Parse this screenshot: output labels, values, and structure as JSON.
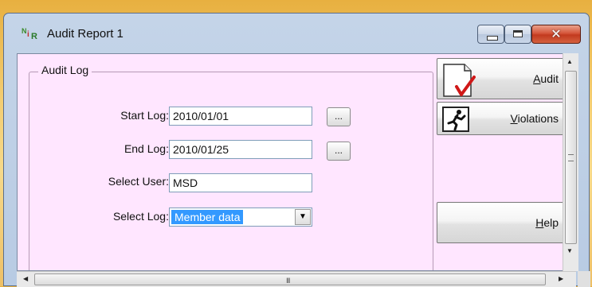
{
  "window": {
    "title": "Audit Report 1",
    "icon": "nir-app-icon"
  },
  "title_buttons": {
    "minimize_icon": "minimize-icon",
    "maximize_icon": "maximize-icon",
    "close_glyph": "✕"
  },
  "audit_log": {
    "legend": "Audit Log",
    "start_log": {
      "label": "Start Log:",
      "value": "2010/01/01",
      "browse": "..."
    },
    "end_log": {
      "label": "End Log:",
      "value": "2010/01/25",
      "browse": "..."
    },
    "select_user": {
      "label": "Select User:",
      "value": "MSD"
    },
    "select_log": {
      "label": "Select Log:",
      "value": "Member data",
      "arrow": "▼"
    }
  },
  "actions": {
    "audit": {
      "label_mnemonic": "A",
      "label_rest": "udit",
      "icon": "audit-document-check-icon"
    },
    "violations": {
      "label_mnemonic": "V",
      "label_rest": "iolations",
      "icon": "running-man-exit-icon"
    },
    "help": {
      "label_mnemonic": "H",
      "label_rest": "elp"
    }
  },
  "scrollbars": {
    "up_arrow": "▲",
    "down_arrow": "▼",
    "left_arrow": "◀",
    "right_arrow": "▶",
    "h_grip": "III"
  }
}
